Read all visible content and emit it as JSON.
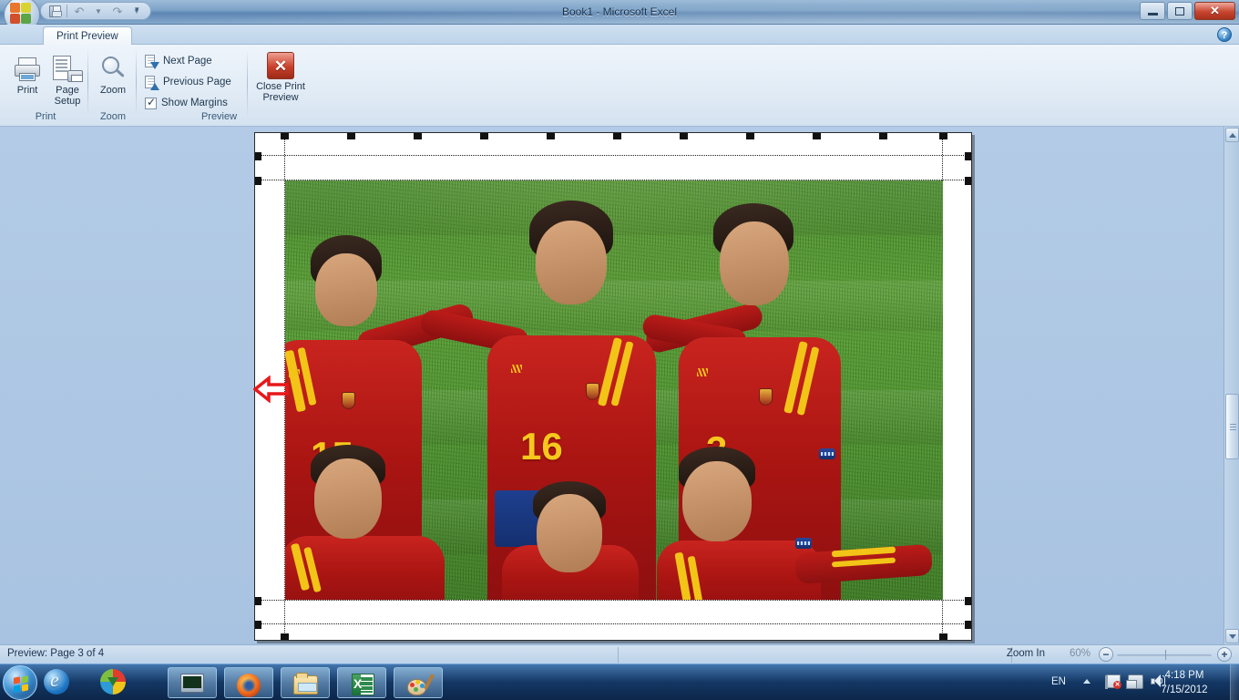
{
  "window": {
    "title": "Book1 - Microsoft Excel",
    "minimize_label": "Minimize",
    "restore_label": "Restore Down",
    "close_label": "Close"
  },
  "quick_access": {
    "items": [
      {
        "name": "save-icon",
        "label": "Save"
      },
      {
        "name": "undo-icon",
        "label": "Undo"
      },
      {
        "name": "redo-icon",
        "label": "Redo"
      }
    ],
    "customize_label": "Customize Quick Access Toolbar"
  },
  "ribbon": {
    "tab_label": "Print Preview",
    "help_label": "?",
    "groups": [
      {
        "label": "Print",
        "buttons": [
          {
            "label": "Print",
            "icon": "printer-icon"
          },
          {
            "label": "Page\nSetup",
            "line1": "Page",
            "line2": "Setup",
            "icon": "page-setup-icon"
          }
        ]
      },
      {
        "label": "Zoom",
        "buttons": [
          {
            "label": "Zoom",
            "icon": "magnifier-icon"
          }
        ]
      },
      {
        "label": "Preview",
        "items": [
          {
            "label": "Next Page",
            "icon": "next-page-icon"
          },
          {
            "label": "Previous Page",
            "icon": "previous-page-icon"
          },
          {
            "label": "Show Margins",
            "icon": "checkbox-icon",
            "checked": true
          }
        ],
        "close_button": {
          "line1": "Close Print",
          "line2": "Preview",
          "icon": "close-x-icon"
        }
      }
    ]
  },
  "preview": {
    "page_content_description": "Spain national football team photograph on grass",
    "players": [
      {
        "number": "15"
      },
      {
        "number": "16"
      },
      {
        "number": "3"
      }
    ],
    "annotation": {
      "name": "red-left-arrow",
      "color": "#e8171a"
    }
  },
  "statusbar": {
    "preview_text": "Preview: Page 3 of 4",
    "zoom_label": "Zoom In",
    "zoom_value": "60%",
    "zoom_out_symbol": "−",
    "zoom_in_symbol": "+"
  },
  "taskbar": {
    "start_label": "Start",
    "quick_launch": [
      {
        "name": "internet-explorer-icon",
        "label": "Internet Explorer"
      },
      {
        "name": "internet-download-manager-icon",
        "label": "Internet Download Manager"
      }
    ],
    "tasks": [
      {
        "name": "system-monitor-icon",
        "label": "System Monitor"
      },
      {
        "name": "firefox-icon",
        "label": "Mozilla Firefox"
      },
      {
        "name": "file-explorer-icon",
        "label": "Windows Explorer"
      },
      {
        "name": "excel-icon",
        "label": "Microsoft Excel"
      },
      {
        "name": "paint-icon",
        "label": "Paint"
      }
    ],
    "tray": {
      "language": "EN",
      "show_hidden_label": "Show hidden icons",
      "icons": [
        {
          "name": "action-center-flag-icon",
          "label": "Action Center"
        },
        {
          "name": "network-icon",
          "label": "Network"
        },
        {
          "name": "volume-icon",
          "label": "Volume"
        }
      ],
      "time": "4:18 PM",
      "date": "7/15/2012"
    }
  },
  "colors": {
    "accent": "#2f7fc4",
    "close_red": "#c8402a",
    "annotation_red": "#e8171a",
    "jersey_red": "#aa1512",
    "jersey_yellow": "#f2c417",
    "grass_green": "#529334"
  }
}
